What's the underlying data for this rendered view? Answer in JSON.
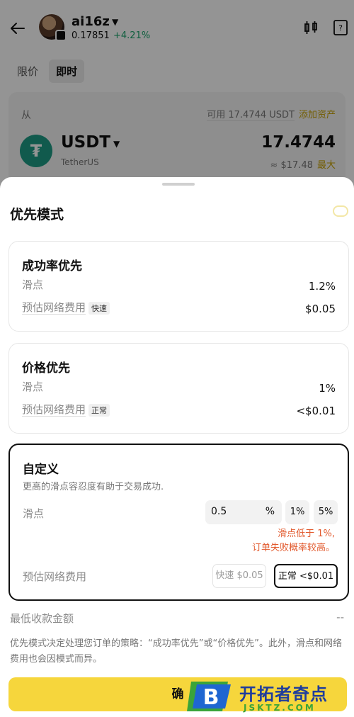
{
  "header": {
    "token_name": "ai16z",
    "token_price": "0.17851",
    "token_change": "+4.21%",
    "icons": [
      "back-arrow-icon",
      "avatar",
      "chart-icon",
      "book-icon"
    ]
  },
  "tabs": [
    "限价",
    "即时"
  ],
  "active_tab": "即时",
  "from_card": {
    "label": "从",
    "available": "可用 17.4744 USDT",
    "add_asset": "添加资产",
    "symbol": "USDT",
    "network": "TetherUS",
    "amount": "17.4744",
    "usd_value": "≈ $17.48",
    "max_label": "最大"
  },
  "sheet": {
    "title": "优先模式",
    "options": [
      {
        "title": "成功率优先",
        "slippage_label": "滑点",
        "slippage_value": "1.2%",
        "fee_label": "预估网络费用",
        "fee_tag": "快速",
        "fee_value": "$0.05"
      },
      {
        "title": "价格优先",
        "slippage_label": "滑点",
        "slippage_value": "1%",
        "fee_label": "预估网络费用",
        "fee_tag": "正常",
        "fee_value": "<$0.01"
      }
    ],
    "custom": {
      "title": "自定义",
      "description": "更高的滑点容忍度有助于交易成功.",
      "slippage_label": "滑点",
      "slippage_input": "0.5",
      "slippage_unit": "%",
      "chip_1": "1%",
      "chip_5": "5%",
      "warning_line1": "滑点低于 1%,",
      "warning_line2": "订单失败概率较高。",
      "fee_label": "预估网络费用",
      "fee_fast": "快速 $0.05",
      "fee_normal": "正常 <$0.01"
    },
    "min_receive_label": "最低收款金额",
    "min_receive_value": "--",
    "footnote": "优先模式决定处理您订单的策略：“成功率优先”或“价格优先”。此外，滑点和网络费用也会因模式而异。",
    "confirm_label": "确"
  },
  "watermark": {
    "letter": "B",
    "text": "开拓者奇点",
    "domain": "JSKTZ.COM"
  },
  "colors": {
    "accent_yellow": "#f6d63c",
    "positive_green": "#1aa46b",
    "warning_red": "#e25a2e",
    "usdt_green": "#1e9b85",
    "link_gold": "#c7a000"
  }
}
